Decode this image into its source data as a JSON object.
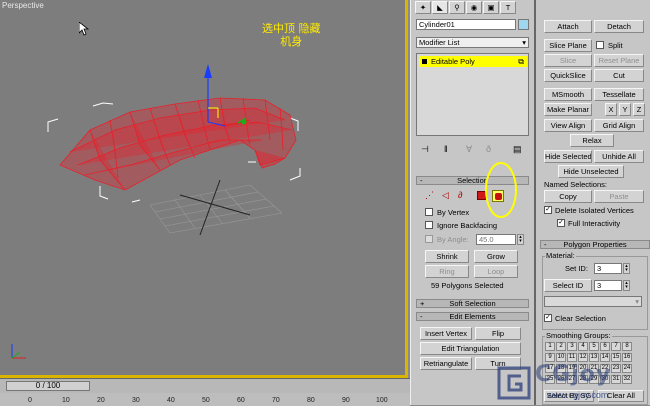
{
  "viewport": {
    "label": "Perspective",
    "annotation_line1": "选中顶 隐藏",
    "annotation_line2": "机身"
  },
  "timeline": {
    "slider_value": "0 / 100",
    "ticks": [
      "0",
      "10",
      "20",
      "30",
      "40",
      "50",
      "60",
      "70",
      "80",
      "90",
      "100"
    ]
  },
  "modify_panel": {
    "object_name": "Cylinder01",
    "modifier_list": "Modifier List",
    "stack_item": "Editable Poly",
    "selection": {
      "title": "Selection",
      "by_vertex": "By Vertex",
      "ignore_backfacing": "Ignore Backfacing",
      "by_angle": "By Angle:",
      "angle_value": "45.0",
      "shrink": "Shrink",
      "grow": "Grow",
      "ring": "Ring",
      "loop": "Loop",
      "status": "59 Polygons Selected"
    },
    "soft_selection": "Soft Selection",
    "edit_elements": {
      "title": "Edit Elements",
      "insert_vertex": "Insert Vertex",
      "flip": "Flip",
      "edit_triangulation": "Edit Triangulation",
      "retriangulate": "Retriangulate",
      "turn": "Turn"
    }
  },
  "geometry_panel": {
    "attach": "Attach",
    "detach": "Detach",
    "slice_plane": "Slice Plane",
    "split": "Split",
    "slice": "Slice",
    "reset_plane": "Reset Plane",
    "quickslice": "QuickSlice",
    "cut": "Cut",
    "msmooth": "MSmooth",
    "tessellate": "Tessellate",
    "make_planar": "Make Planar",
    "x": "X",
    "y": "Y",
    "z": "Z",
    "view_align": "View Align",
    "grid_align": "Grid Align",
    "relax": "Relax",
    "hide_selected": "Hide Selected",
    "unhide_all": "Unhide All",
    "hide_unselected": "Hide Unselected",
    "named_selections": "Named Selections:",
    "copy": "Copy",
    "paste": "Paste",
    "delete_isolated": "Delete Isolated Vertices",
    "full_interactivity": "Full Interactivity",
    "polygon_properties": "Polygon Properties",
    "material": "Material:",
    "set_id": "Set ID:",
    "set_id_value": "3",
    "select_id": "Select ID",
    "select_id_value": "3",
    "clear_selection": "Clear Selection",
    "smoothing_groups": "Smoothing Groups:",
    "sg_row1": [
      "1",
      "2",
      "3",
      "4",
      "5",
      "6",
      "7",
      "8"
    ],
    "sg_row2": [
      "9",
      "10",
      "11",
      "12",
      "13",
      "14",
      "15",
      "16"
    ],
    "sg_row3": [
      "17",
      "18",
      "19",
      "20",
      "21",
      "22",
      "23",
      "24"
    ],
    "sg_row4": [
      "25",
      "26",
      "27",
      "28",
      "29",
      "30",
      "31",
      "32"
    ],
    "select_by_sg": "Select By SG",
    "clear_all": "Clear All"
  },
  "watermark": {
    "brand": "CGjoy",
    "url": "www.cgjoy.com"
  },
  "colors": {
    "mesh": "#e8202a",
    "highlight": "#ffff00",
    "viewport_bg": "#7d7d7d",
    "active_border": "#d9b500"
  }
}
